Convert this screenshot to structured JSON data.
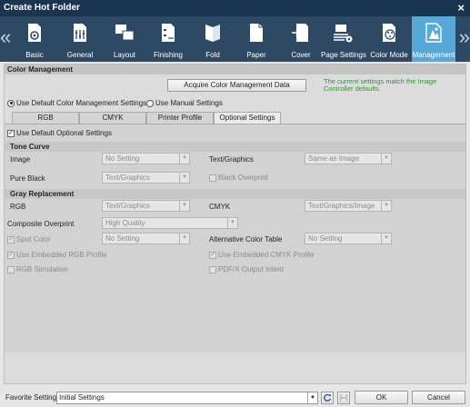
{
  "window": {
    "title": "Create Hot Folder",
    "close_icon": "×"
  },
  "toolbar": {
    "items": [
      {
        "label": "Basic",
        "icon": "basic-icon"
      },
      {
        "label": "General",
        "icon": "general-icon"
      },
      {
        "label": "Layout",
        "icon": "layout-icon"
      },
      {
        "label": "Finishing",
        "icon": "finishing-icon"
      },
      {
        "label": "Fold",
        "icon": "fold-icon"
      },
      {
        "label": "Paper",
        "icon": "paper-icon"
      },
      {
        "label": "Cover",
        "icon": "cover-icon"
      },
      {
        "label": "Page Settings",
        "icon": "page-settings-icon"
      },
      {
        "label": "Color Mode",
        "icon": "color-mode-icon"
      },
      {
        "label": "Management",
        "icon": "management-icon",
        "active": true
      }
    ],
    "prev": "«",
    "next": "»"
  },
  "color_management": {
    "header": "Color Management",
    "acquire_button": "Acquire Color Management Data",
    "note": "The current settings match the Image Controller defaults.",
    "radio_default": "Use Default Color Management Settings",
    "radio_manual": "Use Manual Settings",
    "tabs": [
      "RGB",
      "CMYK",
      "Printer Profile",
      "Optional Settings"
    ],
    "active_tab": "Optional Settings"
  },
  "optional": {
    "use_default": "Use Default Optional Settings",
    "tone_curve": {
      "header": "Tone Curve",
      "image_label": "Image",
      "image_value": "No Setting",
      "textgraphics_label": "Text/Graphics",
      "textgraphics_value": "Same as Image",
      "pure_black_label": "Pure Black",
      "pure_black_value": "Text/Graphics",
      "black_overprint": "Black Overprint"
    },
    "gray_replacement": {
      "header": "Gray Replacement",
      "rgb_label": "RGB",
      "rgb_value": "Text/Graphics",
      "cmyk_label": "CMYK",
      "cmyk_value": "Text/Graphics/Image"
    },
    "composite_overprint_label": "Composite Overprint",
    "composite_overprint_value": "High Quality",
    "spot_color_label": "Spot Color",
    "spot_color_value": "No Setting",
    "alt_color_table_label": "Alternative Color Table",
    "alt_color_table_value": "No Setting",
    "embedded_rgb": "Use Embedded RGB Profile",
    "embedded_cmyk": "Use Embedded CMYK Profile",
    "rgb_simulation": "RGB Simulation",
    "pdfx": "PDF/X Output Intent"
  },
  "footer": {
    "favorite_label": "Favorite Setting",
    "favorite_value": "Initial Settings",
    "refresh_icon": "refresh-icon",
    "save_icon": "save-icon",
    "ok": "OK",
    "cancel": "Cancel"
  },
  "colors": {
    "titlebar": "#1a3550",
    "toolbar": "#2e4964",
    "active_tab": "#56a8d8",
    "note_green": "#2a9a34"
  }
}
